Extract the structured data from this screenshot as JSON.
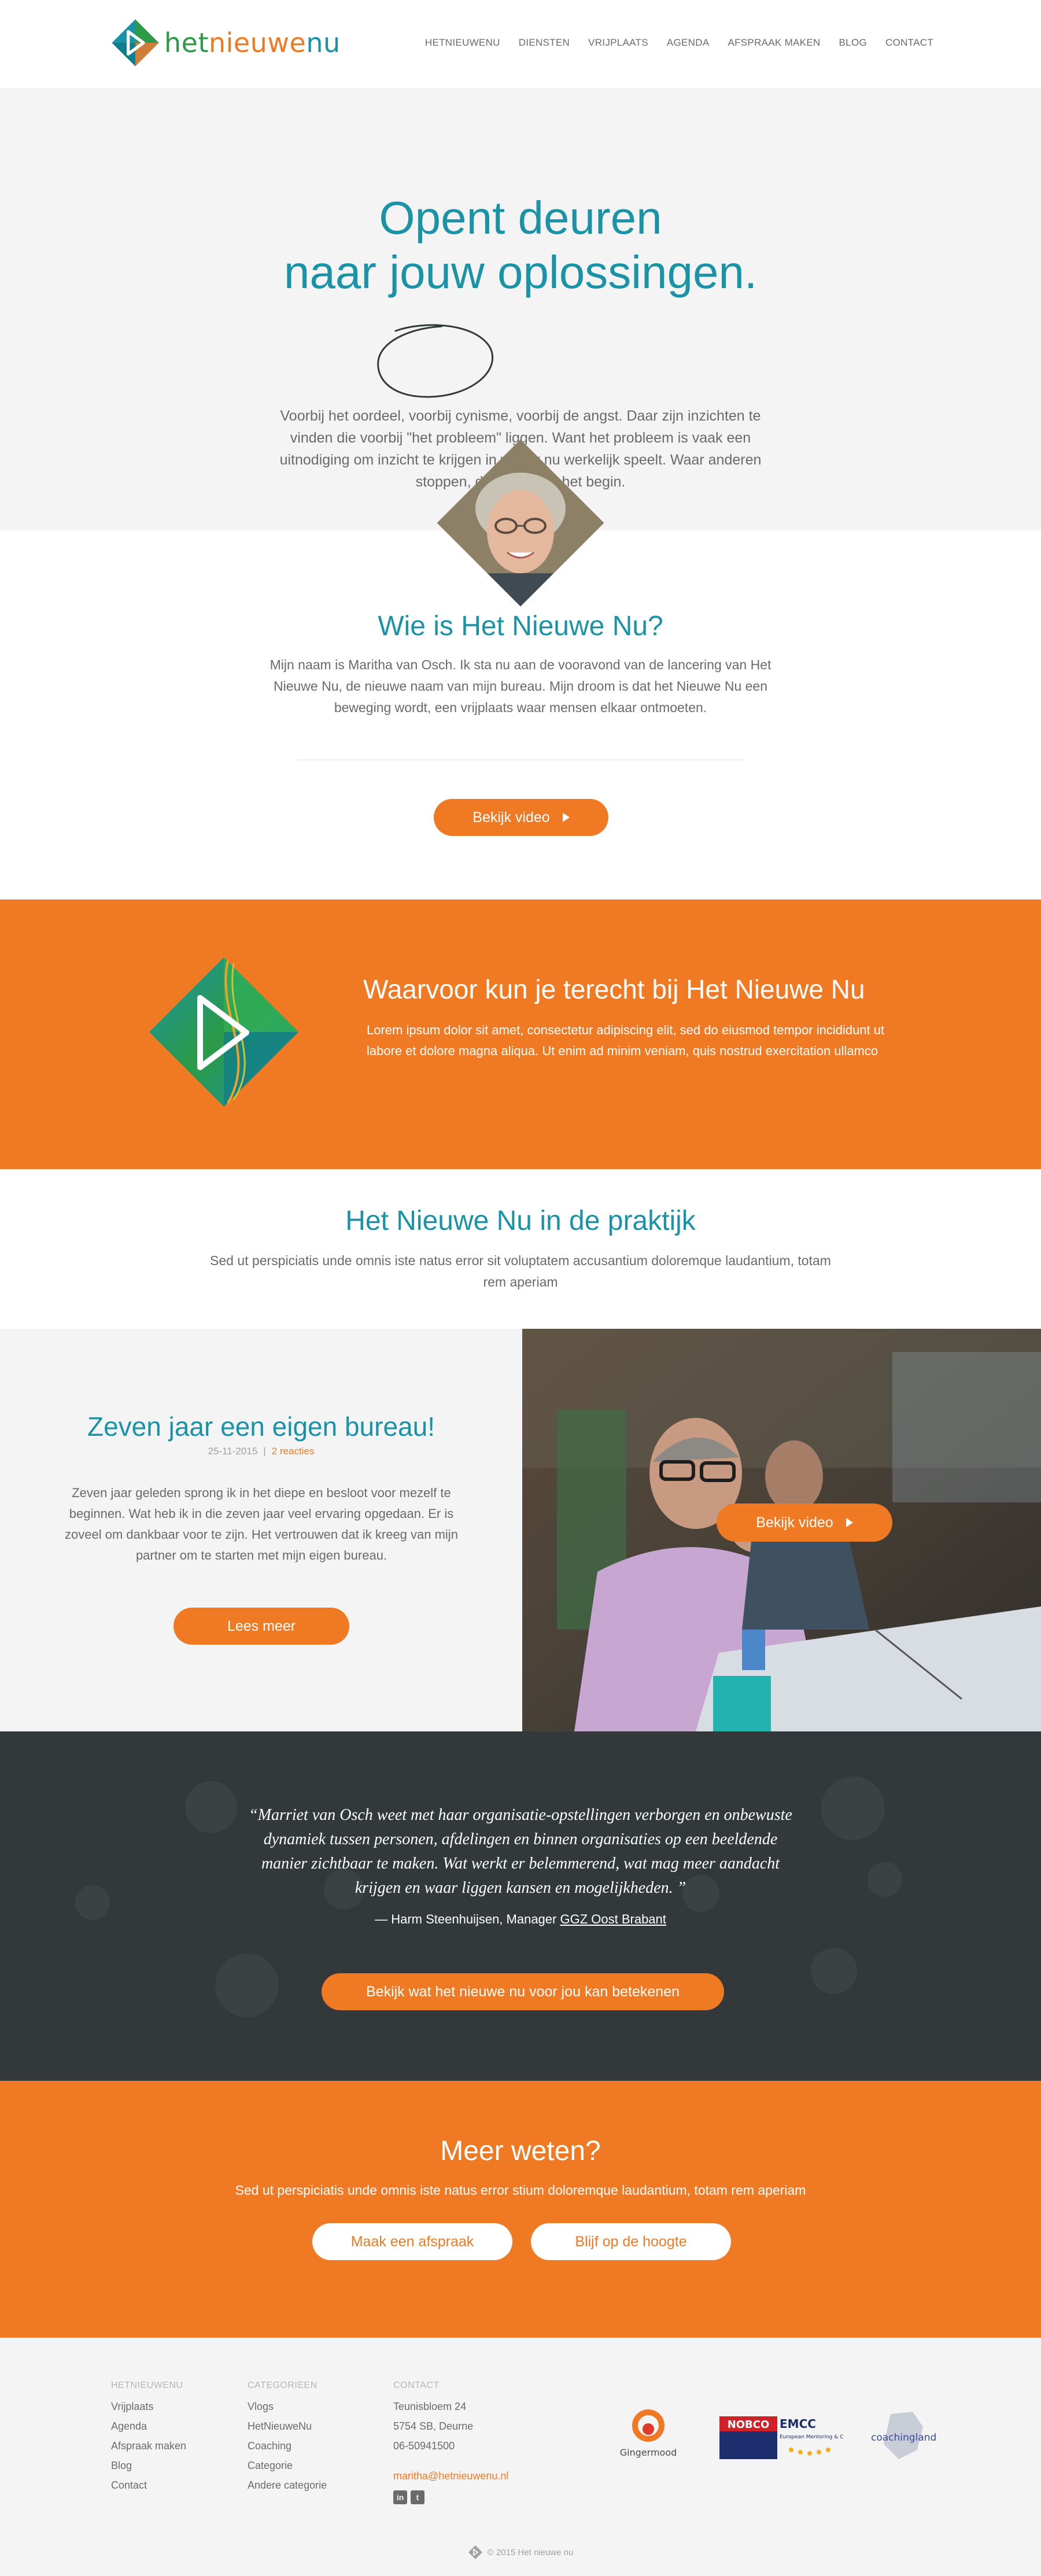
{
  "header": {
    "logo": {
      "part1": "het",
      "part2": "nieuwe",
      "part3": "nu"
    },
    "nav": [
      "HETNIEUWENU",
      "DIENSTEN",
      "VRIJPLAATS",
      "AGENDA",
      "AFSPRAAK MAKEN",
      "BLOG",
      "CONTACT"
    ]
  },
  "hero": {
    "title_line1": "Opent deuren",
    "title_naar": "naar",
    "title_jouw": "jouw",
    "title_end": "oplossingen.",
    "text": "Voorbij het oordeel, voorbij cynisme, voorbij de angst. Daar zijn inzichten te vinden die voorbij \"het probleem\" liggen. Want het probleem is vaak een uitnodiging om inzicht te krijgen in wat er nu werkelijk speelt. Waar anderen stoppen, daar maak ik het begin."
  },
  "who": {
    "title": "Wie is Het Nieuwe Nu?",
    "text": "Mijn naam is Maritha van Osch. Ik sta nu aan de vooravond van de lancering van Het Nieuwe Nu, de nieuwe naam van mijn bureau. Mijn droom is dat het Nieuwe Nu een beweging wordt, een vrijplaats waar mensen elkaar ontmoeten.",
    "button": "Bekijk video"
  },
  "waarvoor": {
    "title": "Waarvoor kun je terecht bij Het Nieuwe Nu",
    "text": "Lorem ipsum dolor sit amet, consectetur adipiscing elit, sed do eiusmod tempor incididunt ut labore et dolore magna aliqua. Ut enim ad minim veniam, quis nostrud exercitation ullamco"
  },
  "praktijk": {
    "title": "Het Nieuwe Nu in de praktijk",
    "text": "Sed ut perspiciatis unde omnis iste natus error sit voluptatem accusantium doloremque laudantium, totam rem aperiam"
  },
  "post": {
    "title": "Zeven jaar een eigen bureau!",
    "date": "25-11-2015",
    "separator": "|",
    "reactions": "2 reacties",
    "text": "Zeven jaar geleden sprong ik in het diepe en besloot voor mezelf te beginnen. Wat heb ik in die zeven jaar veel ervaring opgedaan. Er is zoveel om dankbaar voor te zijn. Het vertrouwen dat ik kreeg van mijn partner om te starten met mijn eigen bureau.",
    "button": "Lees meer",
    "video_button": "Bekijk video"
  },
  "quote": {
    "text": "“Marriet van Osch weet met haar organisatie-opstellingen verborgen en onbewuste dynamiek tussen personen, afdelingen en binnen organisaties op een beeldende manier zichtbaar te maken. Wat werkt er belemmerend, wat mag meer aandacht krijgen en waar liggen kansen en mogelijkheden. ”",
    "author": "— Harm Steenhuijsen, Manager",
    "org": "GGZ Oost Brabant",
    "button": "Bekijk wat het nieuwe nu voor jou kan betekenen"
  },
  "meer": {
    "title": "Meer weten?",
    "text": "Sed ut perspiciatis unde omnis iste natus error stium doloremque laudantium, totam rem aperiam",
    "button1": "Maak een afspraak",
    "button2": "Blijf op de hoogte"
  },
  "footer": {
    "col1": {
      "head": "HETNIEUWENU",
      "items": [
        "Vrijplaats",
        "Agenda",
        "Afspraak maken",
        "Blog",
        "Contact"
      ]
    },
    "col2": {
      "head": "CATEGORIEEN",
      "items": [
        "Vlogs",
        "HetNieuweNu",
        "Coaching",
        "Categorie",
        "Andere categorie"
      ]
    },
    "col3": {
      "head": "CONTACT",
      "address1": "Teunisbloem 24",
      "address2": "5754 SB, Deurne",
      "phone": "06-50941500",
      "email": "maritha@hetnieuwenu.nl"
    },
    "partners": {
      "gingermood": "Gingermood",
      "nobco": "NOBCO",
      "emcc": "EMCC",
      "emcc_sub": "European Mentoring & Coaching Council",
      "coaching": "coachingland"
    },
    "copyright": "© 2015 Het nieuwe nu"
  },
  "colors": {
    "teal": "#1a93a6",
    "orange": "#f07a24",
    "dark": "#33393b",
    "light": "#f4f4f4"
  }
}
